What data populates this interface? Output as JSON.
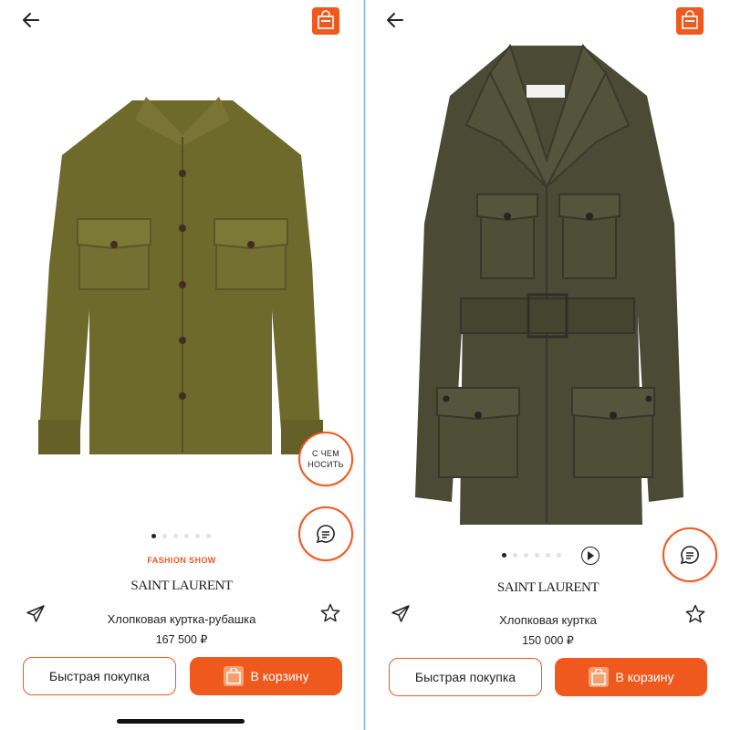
{
  "colors": {
    "accent": "#f0591e",
    "jacket_left": "#6e6a2c",
    "jacket_right": "#4a4a35"
  },
  "icons": {
    "back": "arrow-left-icon",
    "bag": "shopping-bag-icon",
    "share": "paper-plane-icon",
    "favorite": "star-icon",
    "chat": "chat-bubble-icon",
    "play": "play-icon",
    "cart": "shopping-bag-icon"
  },
  "left": {
    "wear_label": "С ЧЕМ НОСИТЬ",
    "gallery": {
      "total_dots": 6,
      "active_index": 0
    },
    "fashion_label": "FASHION SHOW",
    "brand": "SAINT LAURENT",
    "title": "Хлопковая куртка-рубашка",
    "price": "167 500 ₽",
    "quick_buy_label": "Быстрая покупка",
    "cart_label": "В корзину"
  },
  "right": {
    "gallery": {
      "total_dots": 6,
      "active_index": 0,
      "has_video": true
    },
    "brand": "SAINT LAURENT",
    "title": "Хлопковая куртка",
    "price": "150 000 ₽",
    "quick_buy_label": "Быстрая покупка",
    "cart_label": "В корзину"
  }
}
